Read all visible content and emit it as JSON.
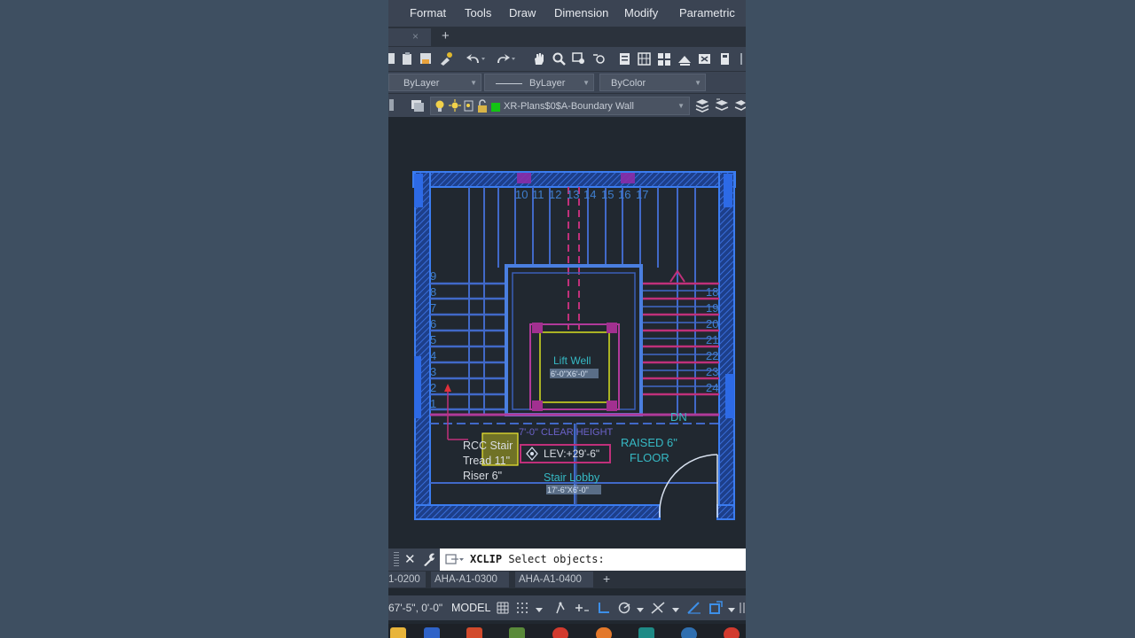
{
  "menubar": {
    "items": [
      "Format",
      "Tools",
      "Draw",
      "Dimension",
      "Modify",
      "Parametric"
    ]
  },
  "file_tabs": {
    "close_label": "×",
    "new_label": "+"
  },
  "properties": {
    "color": "ByLayer",
    "linetype": "ByLayer",
    "lineweight": "ByColor"
  },
  "layer": {
    "current": "XR-Plans$0$A-Boundary Wall",
    "swatch_color": "#13c313"
  },
  "drawing": {
    "top_numbers": [
      "10",
      "11",
      "12",
      "13",
      "14",
      "15",
      "16",
      "17"
    ],
    "left_numbers": [
      "9",
      "8",
      "7",
      "6",
      "5",
      "4",
      "3",
      "2",
      "1"
    ],
    "right_numbers": [
      "18",
      "19",
      "20",
      "21",
      "22",
      "23",
      "24"
    ],
    "lift_label": "Lift Well",
    "lift_dim": "6'-0\"X6'-0\"",
    "dn_label": "DN",
    "clear_height": "7'-0\" CLEAR HEIGHT",
    "stair_note": [
      "RCC Stair",
      "Tread 11\"",
      "Riser 6\""
    ],
    "level_tag": "LEV:+29'-6\"",
    "raised_floor": [
      "RAISED 6\"",
      "FLOOR"
    ],
    "lobby_label": "Stair Lobby",
    "lobby_dim": "17'-6\"X6'-0\"",
    "colors": {
      "wall": "#3a7cf0",
      "wall_hatch": "#2f63d9",
      "steps": "#4169c8",
      "magenta": "#c0307a",
      "cyan_text": "#36b9c4",
      "label_text": "#3f7fcf",
      "highlight": "#e8e21a"
    }
  },
  "command": {
    "name": "XCLIP",
    "prompt": "Select objects:"
  },
  "layout_tabs": [
    "1-0200",
    "AHA-A1-0300",
    "AHA-A1-0400"
  ],
  "layout_new": "+",
  "status": {
    "coordinates": "67'-5\", 0'-0\"",
    "model": "MODEL"
  }
}
